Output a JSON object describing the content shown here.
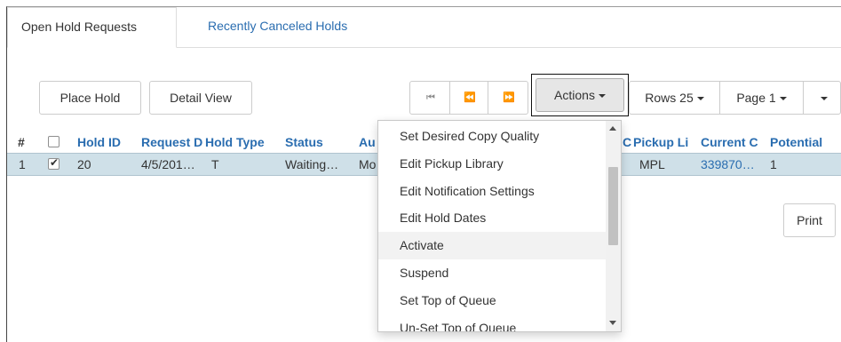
{
  "tabs": [
    {
      "label": "Open Hold Requests"
    },
    {
      "label": "Recently Canceled Holds"
    }
  ],
  "toolbar": {
    "place_hold": "Place Hold",
    "detail_view": "Detail View",
    "first_icon": "⏮",
    "prev_icon": "⏪",
    "next_icon": "⏩",
    "actions": "Actions",
    "rows": "Rows 25",
    "page": "Page 1"
  },
  "grid": {
    "headers": {
      "index": "#",
      "hold_id": "Hold ID",
      "request_date": "Request D",
      "hold_type": "Hold Type",
      "status": "Status",
      "author": "Au",
      "col_c": "C",
      "pickup_lib": "Pickup Li",
      "current_copy": "Current C",
      "potential": "Potential"
    },
    "rows": [
      {
        "index": "1",
        "checked": true,
        "hold_id": "20",
        "request_date": "4/5/201…",
        "hold_type": "T",
        "status": "Waiting…",
        "author": "Mo",
        "pickup_lib": "MPL",
        "current_copy": "339870…",
        "potential": "1"
      }
    ]
  },
  "print": "Print",
  "actions_menu": {
    "items": [
      {
        "label": "Set Desired Copy Quality"
      },
      {
        "label": "Edit Pickup Library"
      },
      {
        "label": "Edit Notification Settings"
      },
      {
        "label": "Edit Hold Dates"
      },
      {
        "label": "Activate"
      },
      {
        "label": "Suspend"
      },
      {
        "label": "Set Top of Queue"
      },
      {
        "label": "Un-Set Top of Queue"
      }
    ],
    "hovered_index": 4
  },
  "colors": {
    "link": "#2a6db0",
    "selected_row": "#cfe0e8",
    "active_button": "#e6e6e6"
  }
}
